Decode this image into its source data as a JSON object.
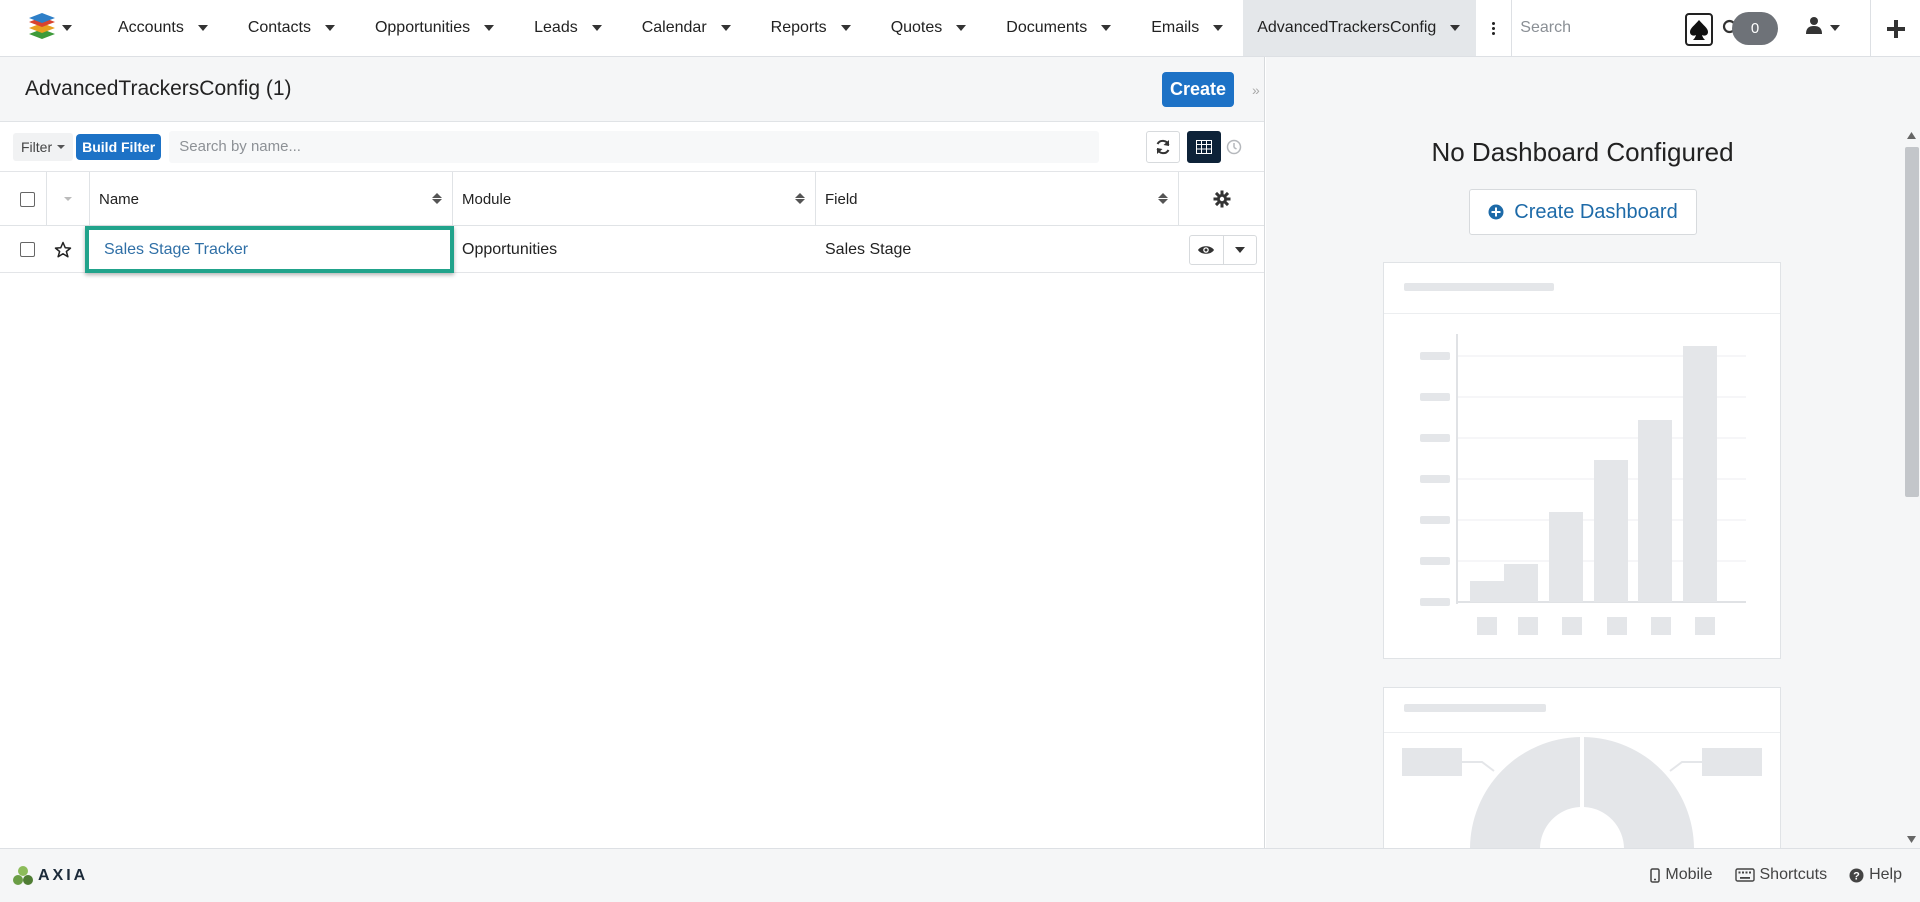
{
  "nav": {
    "items": [
      {
        "label": "Accounts"
      },
      {
        "label": "Contacts"
      },
      {
        "label": "Opportunities"
      },
      {
        "label": "Leads"
      },
      {
        "label": "Calendar"
      },
      {
        "label": "Reports"
      },
      {
        "label": "Quotes"
      },
      {
        "label": "Documents"
      },
      {
        "label": "Emails"
      }
    ],
    "active_item": "AdvancedTrackersConfig",
    "search_placeholder": "Search",
    "notification_count": "0"
  },
  "page": {
    "title": "AdvancedTrackersConfig (1)",
    "create_label": "Create"
  },
  "filter": {
    "filter_label": "Filter",
    "build_filter_label": "Build Filter",
    "search_placeholder": "Search by name..."
  },
  "table": {
    "columns": [
      "Name",
      "Module",
      "Field"
    ],
    "rows": [
      {
        "name": "Sales Stage Tracker",
        "module": "Opportunities",
        "field": "Sales Stage"
      }
    ]
  },
  "dashboard": {
    "title": "No Dashboard Configured",
    "create_label": "Create Dashboard"
  },
  "footer": {
    "brand": "AXIA",
    "mobile_label": "Mobile",
    "shortcuts_label": "Shortcuts",
    "help_label": "Help"
  },
  "colors": {
    "accent": "#1d72c6",
    "highlight_border": "#21a38b",
    "placeholder_gray": "#e4e6e9"
  }
}
